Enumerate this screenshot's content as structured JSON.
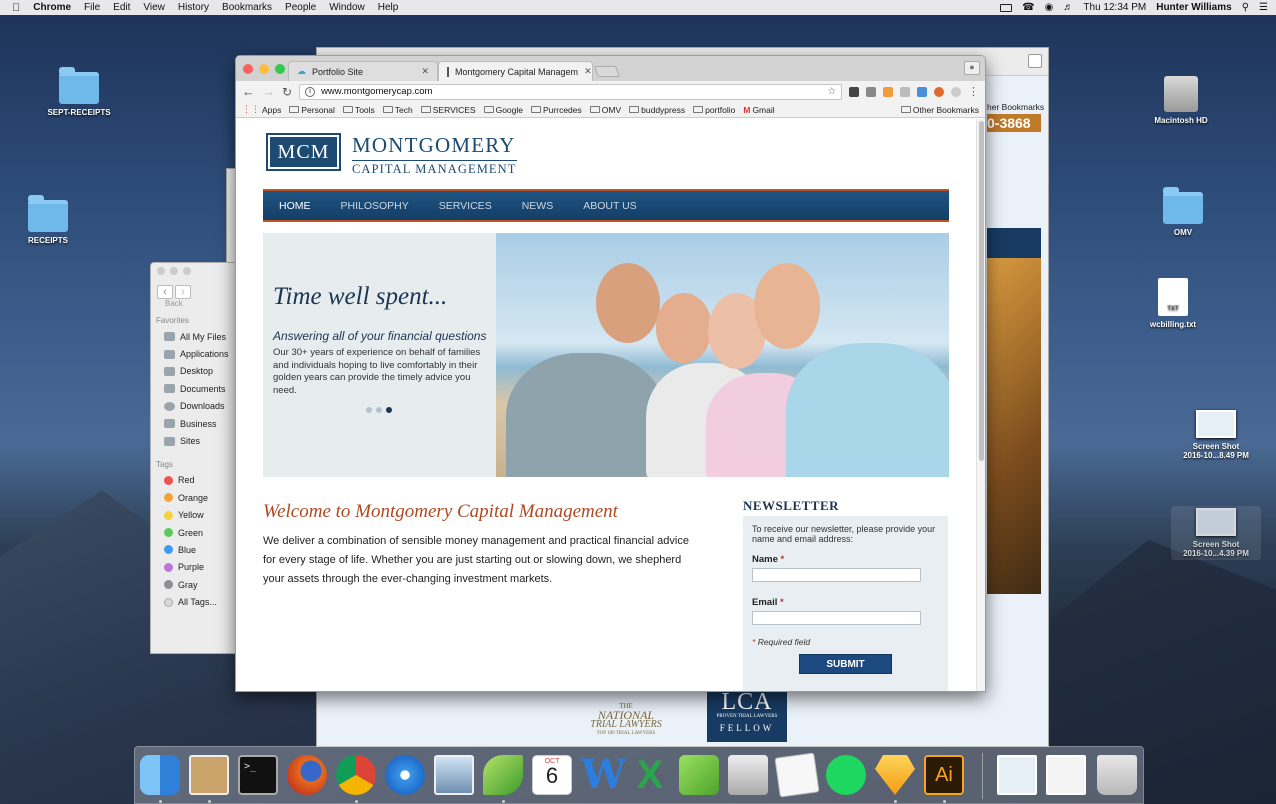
{
  "menubar": {
    "apple": "",
    "app": "Chrome",
    "items": [
      "File",
      "Edit",
      "View",
      "History",
      "Bookmarks",
      "People",
      "Window",
      "Help"
    ],
    "clock": "Thu 12:34 PM",
    "user": "Hunter Williams"
  },
  "desktop": {
    "icons": [
      {
        "label": "SEPT-RECEIPTS"
      },
      {
        "label": "RECEIPTS"
      },
      {
        "label": "Macintosh HD"
      },
      {
        "label": "OMV"
      },
      {
        "label": "wcbilling.txt",
        "badge": "TXT"
      },
      {
        "label1": "Screen Shot",
        "label2": "2016-10...8.49 PM"
      },
      {
        "label1": "Screen Shot",
        "label2": "2016-10...4.39 PM"
      }
    ]
  },
  "bg_window": {
    "phone": "0-3868",
    "bookmarks_fragment": "her Bookmarks",
    "logo_lines": [
      "THE",
      "NATIONAL",
      "TRIAL LAWYERS",
      "TOP 100 TRIAL LAWYERS"
    ],
    "lca": "LCA",
    "lca_sub": "PROVEN TRIAL LAWYERS",
    "fellow": "FELLOW"
  },
  "finder": {
    "back": "Back",
    "favorites_title": "Favorites",
    "favorites": [
      "All My Files",
      "Applications",
      "Desktop",
      "Documents",
      "Downloads",
      "Business",
      "Sites"
    ],
    "tags_title": "Tags",
    "tags": [
      {
        "label": "Red",
        "color": "#f0524d"
      },
      {
        "label": "Orange",
        "color": "#f4a13a"
      },
      {
        "label": "Yellow",
        "color": "#f5d33f"
      },
      {
        "label": "Green",
        "color": "#5cc95a"
      },
      {
        "label": "Blue",
        "color": "#3d9cf0"
      },
      {
        "label": "Purple",
        "color": "#bf76d7"
      },
      {
        "label": "Gray",
        "color": "#8e8e93"
      },
      {
        "label": "All Tags...",
        "color": "#d8d8d8"
      }
    ]
  },
  "chrome": {
    "tabs": [
      {
        "title": "Portfolio Site"
      },
      {
        "title": "Montgomery Capital Managem"
      }
    ],
    "url": "www.montgomerycap.com",
    "bookmarks": [
      "Apps",
      "Personal",
      "Tools",
      "Tech",
      "SERVICES",
      "Google",
      "Purrcedes",
      "OMV",
      "buddypress",
      "portfolio",
      "Gmail"
    ],
    "other_bookmarks": "Other Bookmarks"
  },
  "site": {
    "logo": "MCM",
    "brand_line1": "MONTGOMERY",
    "brand_line2": "CAPITAL MANAGEMENT",
    "nav": [
      "HOME",
      "PHILOSOPHY",
      "SERVICES",
      "NEWS",
      "ABOUT US"
    ],
    "hero": {
      "title": "Time well spent...",
      "subtitle": "Answering all of your financial questions",
      "body": "Our 30+ years of experience on behalf of families and individuals hoping to live comfortably in their golden years can provide the timely advice you need."
    },
    "welcome": "Welcome to Montgomery Capital Management",
    "intro": "We deliver a combination of sensible money management and practical financial advice for every stage of life. Whether you are just starting out or slowing down, we shepherd your assets through the ever-changing investment markets.",
    "newsletter": {
      "title": "NEWSLETTER",
      "text": "To receive our newsletter, please provide your name and email address:",
      "name_label": "Name",
      "email_label": "Email",
      "required": "Required field",
      "star": "*",
      "submit": "SUBMIT"
    }
  },
  "dock": {
    "calendar_month": "OCT",
    "calendar_day": "6"
  }
}
